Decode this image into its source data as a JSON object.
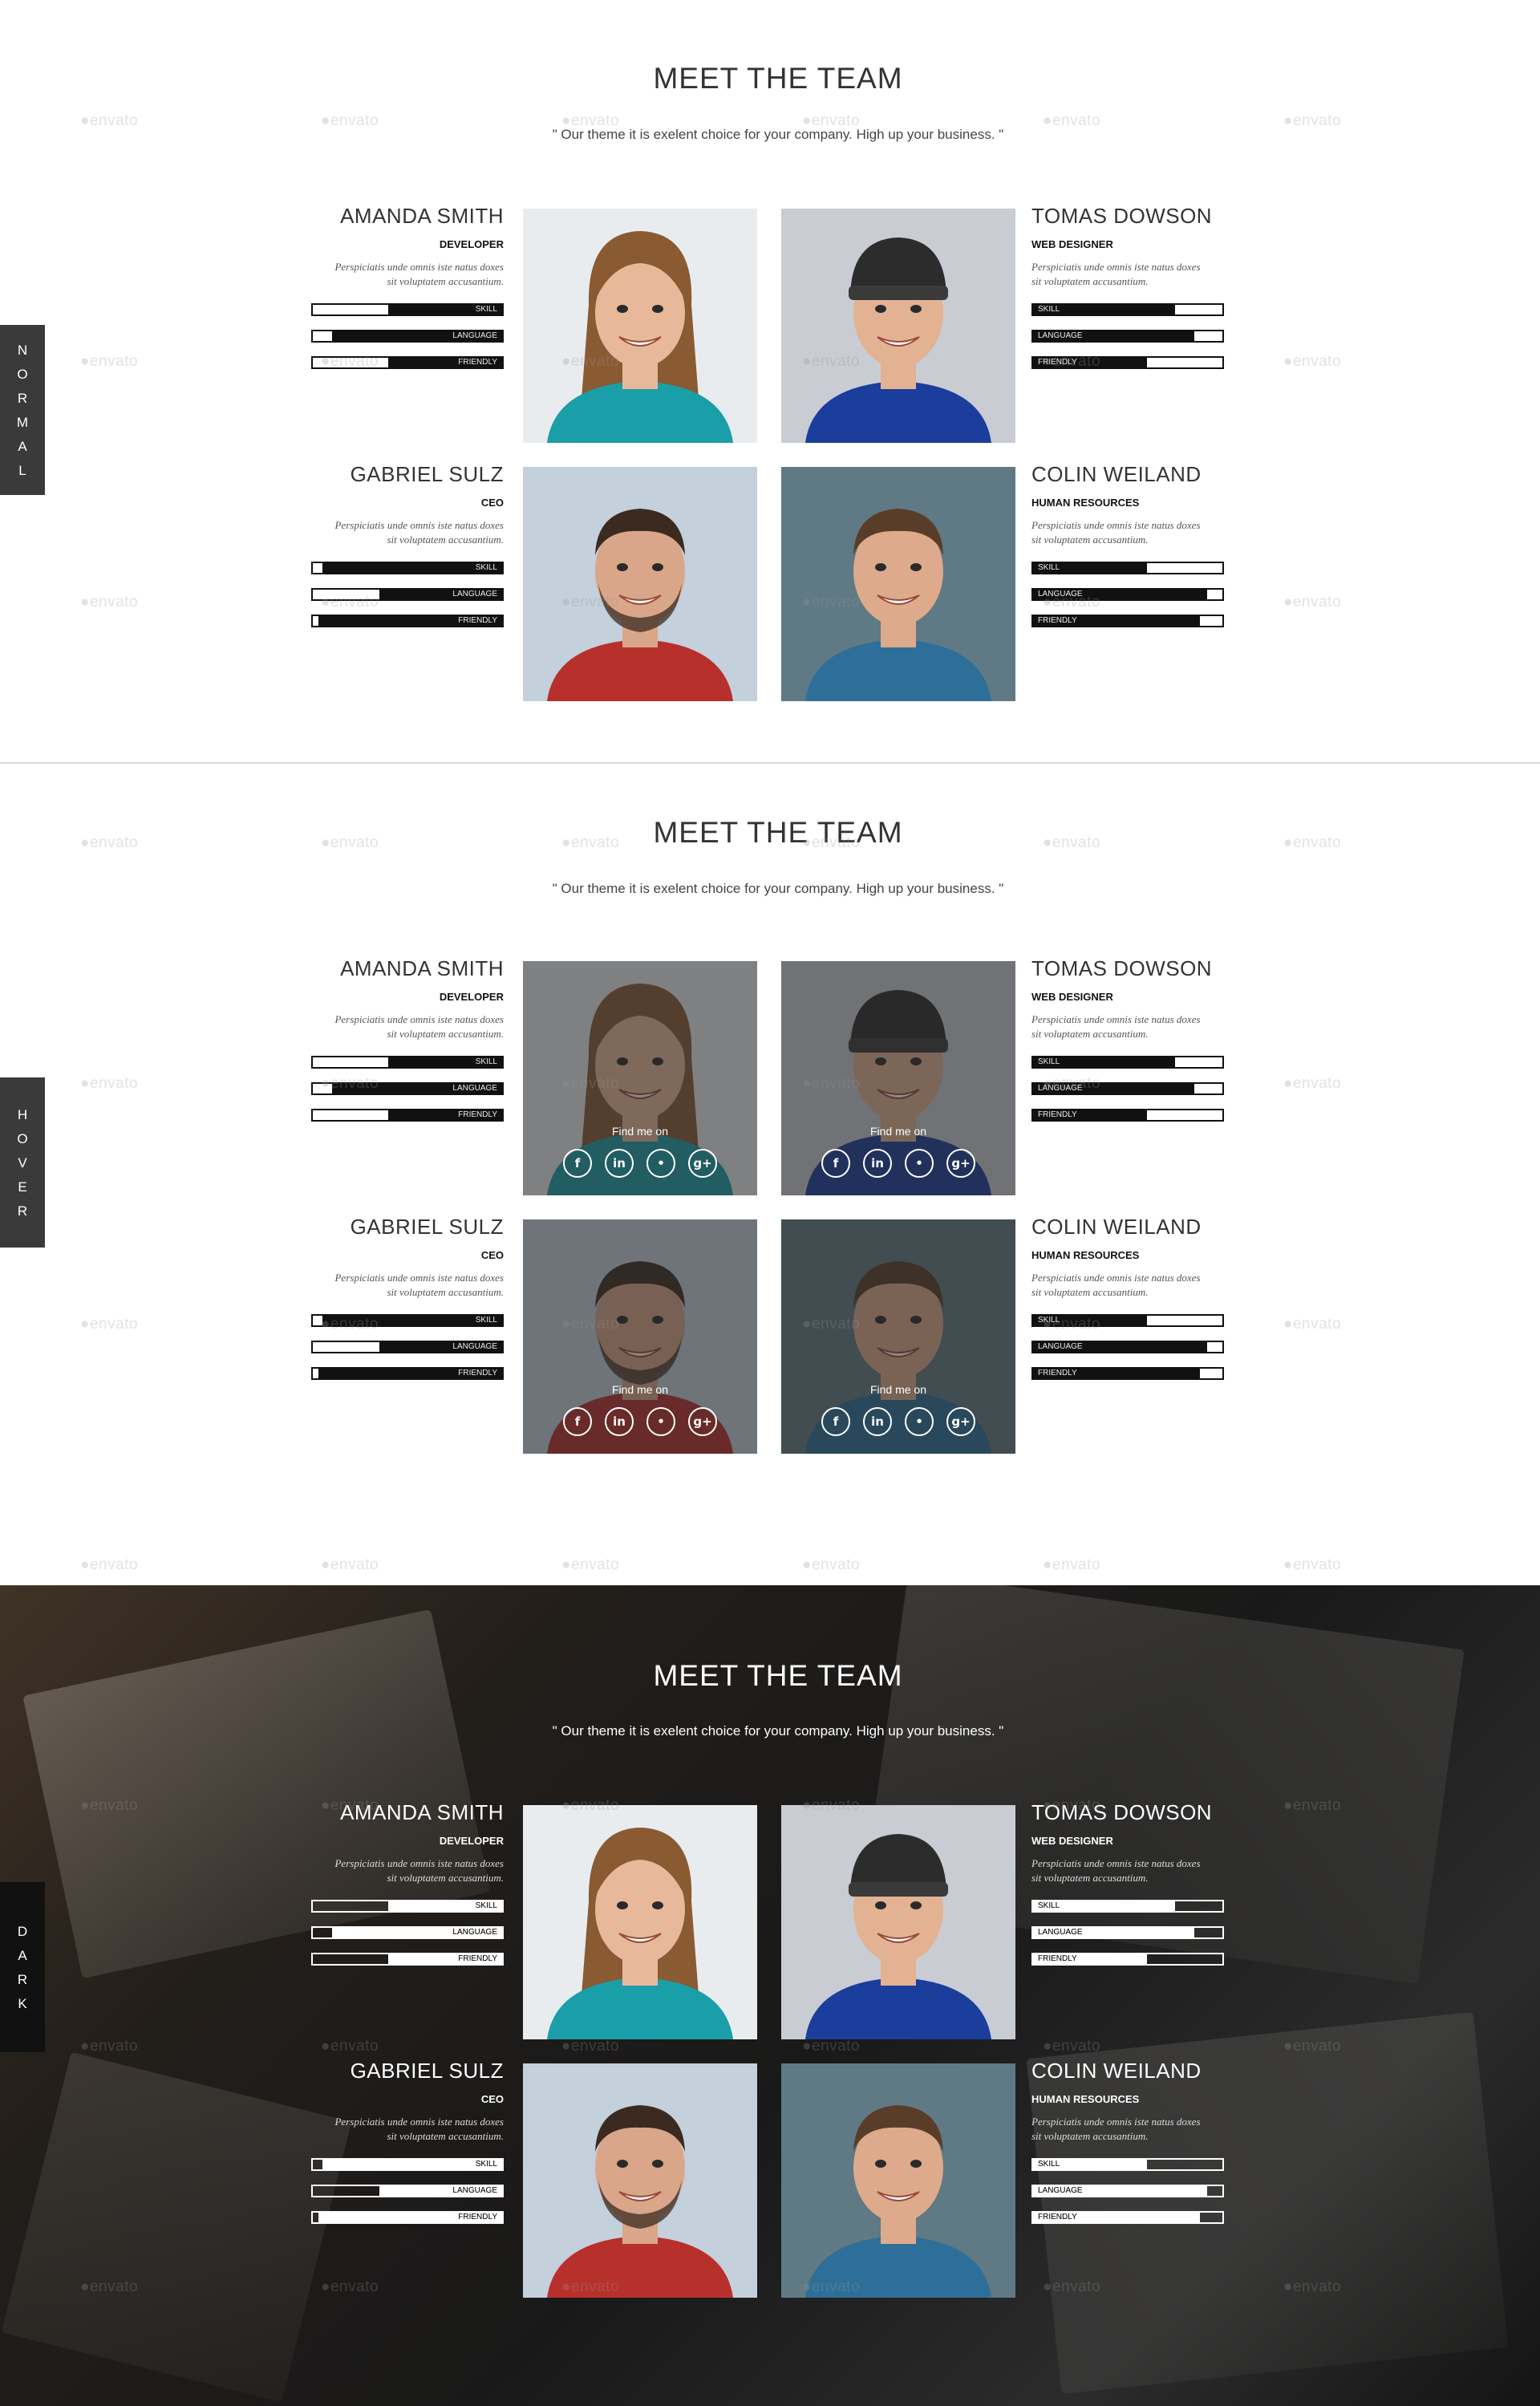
{
  "sections": {
    "normal": {
      "tab": "NORMAL",
      "title": "MEET THE TEAM",
      "subtitle": "\" Our theme it is exelent choice for your company. High up your business. \""
    },
    "hover": {
      "tab": "HOVER",
      "title": "MEET THE TEAM",
      "subtitle": "\" Our theme it is exelent choice for your company. High up your business. \""
    },
    "dark": {
      "tab": "DARK",
      "title": "MEET THE TEAM",
      "subtitle": "\" Our theme it is exelent choice for your company. High up your business. \""
    }
  },
  "hover_text": "Find me on",
  "social_icons": [
    "facebook-icon",
    "linkedin-icon",
    "twitter-icon",
    "google-plus-icon"
  ],
  "social_glyphs": [
    "f",
    "in",
    "•",
    "g+"
  ],
  "watermark": "envato",
  "members": [
    {
      "name": "AMANDA SMITH",
      "role": "DEVELOPER",
      "desc_line1": "Perspiciatis unde omnis iste natus doxes",
      "desc_line2": "sit voluptatem accusantium.",
      "skill": 0.6,
      "language": 0.9,
      "friendly": 0.6,
      "bg": "#e9ecef",
      "skin": "#e8b89a",
      "hair": "#8a5a33",
      "shirt": "#1a9ea8"
    },
    {
      "name": "TOMAS DOWSON",
      "role": "WEB DESIGNER",
      "desc_line1": "Perspiciatis unde omnis iste natus doxes",
      "desc_line2": "sit voluptatem accusantium.",
      "skill": 0.75,
      "language": 0.85,
      "friendly": 0.6,
      "bg": "#c9ccd3",
      "skin": "#e2b293",
      "hair": "#2c2c2c",
      "shirt": "#1b3d9c"
    },
    {
      "name": "GABRIEL SULZ",
      "role": "CEO",
      "desc_line1": "Perspiciatis unde omnis iste natus doxes",
      "desc_line2": "sit voluptatem accusantium.",
      "skill": 0.95,
      "language": 0.65,
      "friendly": 0.97,
      "bg": "#c4d0db",
      "skin": "#d9a689",
      "hair": "#3a2a20",
      "shirt": "#b8302c"
    },
    {
      "name": "COLIN WEILAND",
      "role": "HUMAN RESOURCES",
      "desc_line1": "Perspiciatis unde omnis iste natus doxes",
      "desc_line2": "sit voluptatem accusantium.",
      "skill": 0.6,
      "language": 0.92,
      "friendly": 0.88,
      "bg": "#5f7a84",
      "skin": "#ddaa8c",
      "hair": "#5a3d28",
      "shirt": "#2e6f99"
    }
  ],
  "bar_labels": {
    "skill": "SKILL",
    "language": "LANGUAGE",
    "friendly": "FRIENDLY"
  }
}
